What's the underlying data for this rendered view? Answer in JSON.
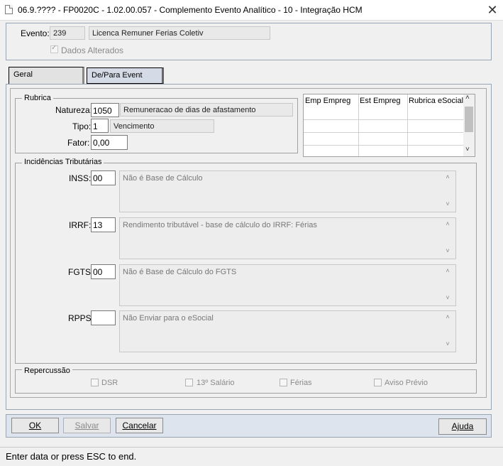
{
  "window": {
    "title": "06.9.???? - FP0020C - 1.02.00.057 - Complemento Evento Analítico - 10 - Integração HCM"
  },
  "header": {
    "evento_label": "Evento:",
    "evento_code": "239",
    "evento_desc": "Licenca Remuner Ferias Coletiv",
    "dados_alterados": "Dados Alterados"
  },
  "tabs": [
    {
      "label": "Geral"
    },
    {
      "label": "De/Para Event"
    }
  ],
  "rubrica": {
    "title": "Rubrica",
    "natureza_label": "Natureza:",
    "natureza_value": "1050",
    "natureza_desc": "Remuneracao de dias de afastamento",
    "tipo_label": "Tipo:",
    "tipo_value": "1",
    "tipo_desc": "Vencimento",
    "fator_label": "Fator:",
    "fator_value": "0,00"
  },
  "grid": {
    "columns": [
      "Emp Empreg",
      "Est Empreg",
      "Rubrica eSocial"
    ]
  },
  "incidencias": {
    "title": "Incidências Tributárias",
    "inss": {
      "label": "INSS:",
      "value": "00",
      "desc": "Não é Base de Cálculo"
    },
    "irrf": {
      "label": "IRRF:",
      "value": "13",
      "desc": "Rendimento tributável - base de cálculo do IRRF: Férias"
    },
    "fgts": {
      "label": "FGTS:",
      "value": "00",
      "desc": "Não é Base de Cálculo do FGTS"
    },
    "rpps": {
      "label": "RPPS:",
      "value": "",
      "desc": "Não Enviar para o eSocial"
    }
  },
  "repercussao": {
    "title": "Repercussão",
    "items": [
      "DSR",
      "13º Salário",
      "Férias",
      "Aviso Prévio"
    ]
  },
  "buttons": {
    "ok": "OK",
    "salvar": "Salvar",
    "cancelar": "Cancelar",
    "ajuda": "Ajuda"
  },
  "status": {
    "text": "Enter data or press ESC to end."
  },
  "icons": {
    "close": "close-icon",
    "check": "check-icon",
    "scroll_up": "chevron-up-icon",
    "scroll_down": "chevron-down-icon"
  }
}
